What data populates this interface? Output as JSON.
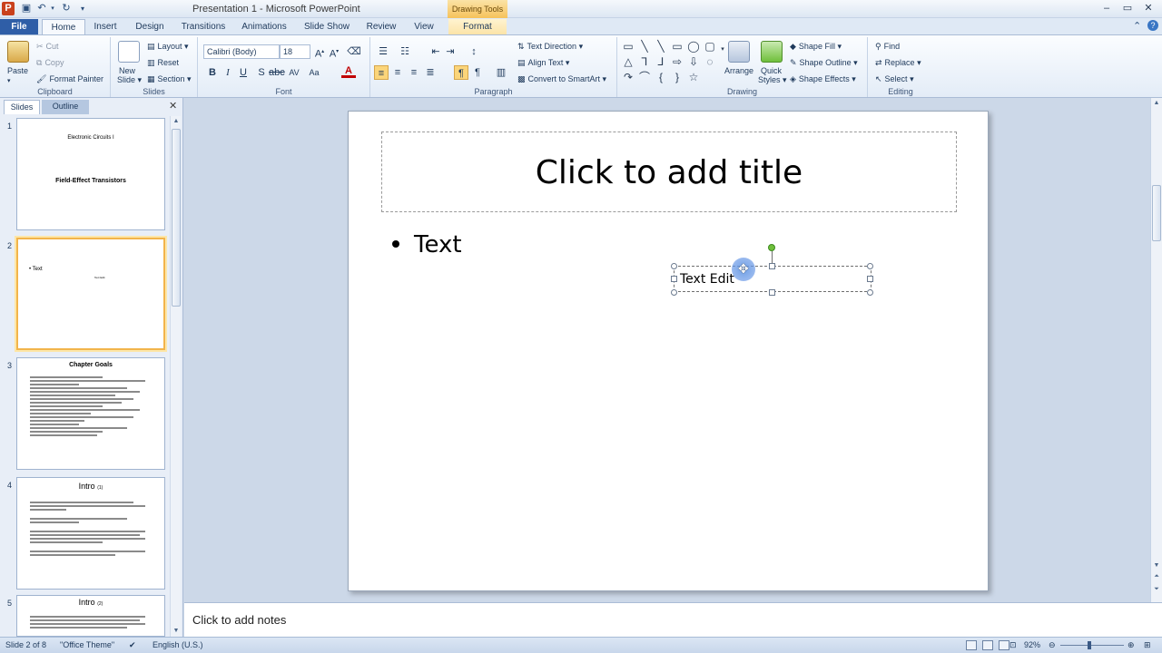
{
  "window": {
    "title": "Presentation 1  -  Microsoft PowerPoint",
    "contextual_tab_group": "Drawing Tools",
    "app_icon": "P"
  },
  "tabs": [
    "File",
    "Home",
    "Insert",
    "Design",
    "Transitions",
    "Animations",
    "Slide Show",
    "Review",
    "View",
    "Format"
  ],
  "ribbon": {
    "clipboard": {
      "label": "Clipboard",
      "paste": "Paste",
      "cut": "Cut",
      "copy": "Copy",
      "format_painter": "Format Painter"
    },
    "slides": {
      "label": "Slides",
      "new_slide_1": "New",
      "new_slide_2": "Slide",
      "layout": "Layout",
      "reset": "Reset",
      "section": "Section"
    },
    "font": {
      "label": "Font",
      "font_name": "Calibri (Body)",
      "font_size": "18"
    },
    "paragraph": {
      "label": "Paragraph",
      "text_direction": "Text Direction",
      "align_text": "Align Text",
      "convert_smartart": "Convert to SmartArt"
    },
    "drawing": {
      "label": "Drawing",
      "arrange": "Arrange",
      "quick_styles_1": "Quick",
      "quick_styles_2": "Styles",
      "shape_fill": "Shape Fill",
      "shape_outline": "Shape Outline",
      "shape_effects": "Shape Effects"
    },
    "editing": {
      "label": "Editing",
      "find": "Find",
      "replace": "Replace",
      "select": "Select"
    }
  },
  "left_pane": {
    "tab_slides": "Slides",
    "tab_outline": "Outline",
    "thumbnails": [
      {
        "number": "1",
        "subtitle": "Electronic Circuits I",
        "title": "Field-Effect Transistors"
      },
      {
        "number": "2",
        "bullet": "Text",
        "small": "Text Edit"
      },
      {
        "number": "3",
        "title": "Chapter Goals"
      },
      {
        "number": "4",
        "title": "Intro",
        "suffix": "(1)"
      },
      {
        "number": "5",
        "title": "Intro",
        "suffix": "(2)"
      }
    ]
  },
  "slide": {
    "title_placeholder": "Click to add title",
    "bullet_text": "Text",
    "textbox_text": "Text Edit"
  },
  "notes": {
    "placeholder": "Click to add notes"
  },
  "status": {
    "slide_of": "Slide 2 of 8",
    "theme": "\"Office Theme\"",
    "language": "English (U.S.)",
    "zoom": "92%"
  },
  "colors": {
    "file_tab": "#2f5ea7",
    "ribbon_bg": "#e3ecf7",
    "canvas_bg": "#ccd8e8",
    "selection": "#f2b44b",
    "rotation_handle": "#6fbf3b"
  }
}
